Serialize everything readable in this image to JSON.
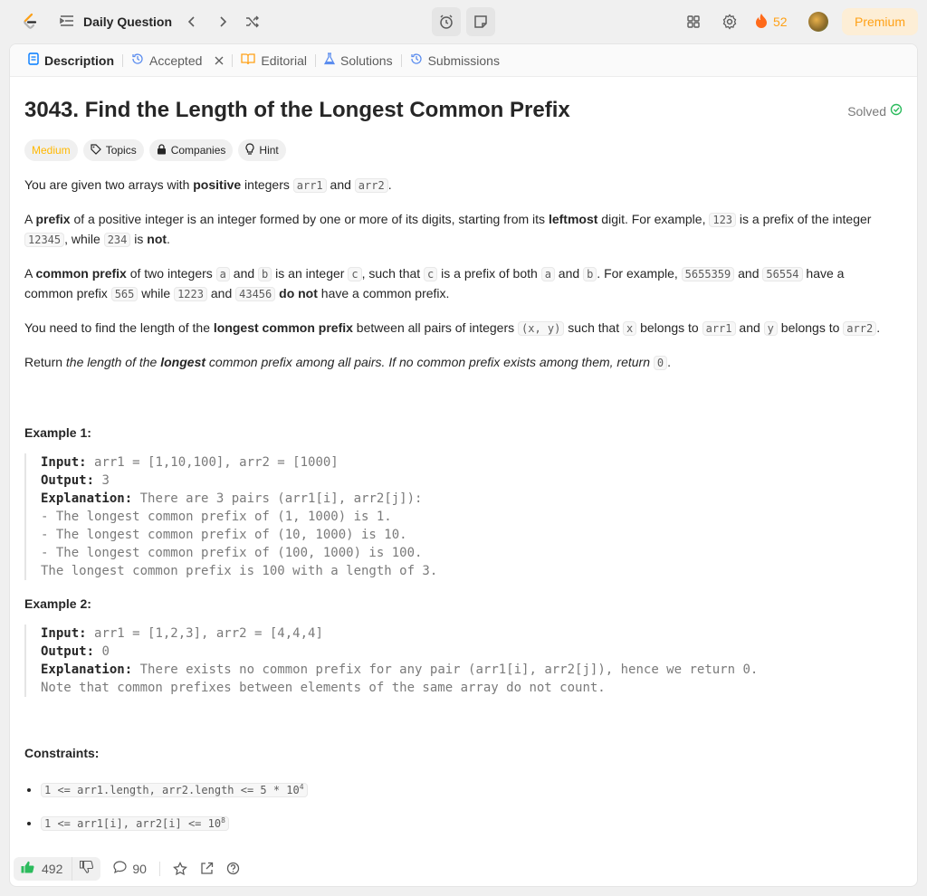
{
  "topbar": {
    "title": "Daily Question",
    "streak_count": "52",
    "premium_label": "Premium"
  },
  "tabs": [
    {
      "label": "Description"
    },
    {
      "label": "Accepted"
    },
    {
      "label": "Editorial"
    },
    {
      "label": "Solutions"
    },
    {
      "label": "Submissions"
    }
  ],
  "problem": {
    "title": "3043. Find the Length of the Longest Common Prefix",
    "status": "Solved",
    "difficulty": "Medium",
    "chips": {
      "topics": "Topics",
      "companies": "Companies",
      "hint": "Hint"
    }
  },
  "example1": {
    "title": "Example 1:",
    "input": "arr1 = [1,10,100], arr2 = [1000]",
    "output": "3",
    "explanation": "There are 3 pairs (arr1[i], arr2[j]):",
    "lines": [
      "- The longest common prefix of (1, 1000) is 1.",
      "- The longest common prefix of (10, 1000) is 10.",
      "- The longest common prefix of (100, 1000) is 100.",
      "The longest common prefix is 100 with a length of 3."
    ]
  },
  "example2": {
    "title": "Example 2:",
    "input": "arr1 = [1,2,3], arr2 = [4,4,4]",
    "output": "0",
    "explanation": "There exists no common prefix for any pair (arr1[i], arr2[j]), hence we return 0.",
    "lines": [
      "Note that common prefixes between elements of the same array do not count."
    ]
  },
  "constraints_title": "Constraints:",
  "footer": {
    "likes": "492",
    "comments": "90"
  },
  "colors": {
    "accent": "#ffa116",
    "medium": "#ffb800",
    "solved": "#2cbb5d",
    "like": "#2cbb5d"
  }
}
